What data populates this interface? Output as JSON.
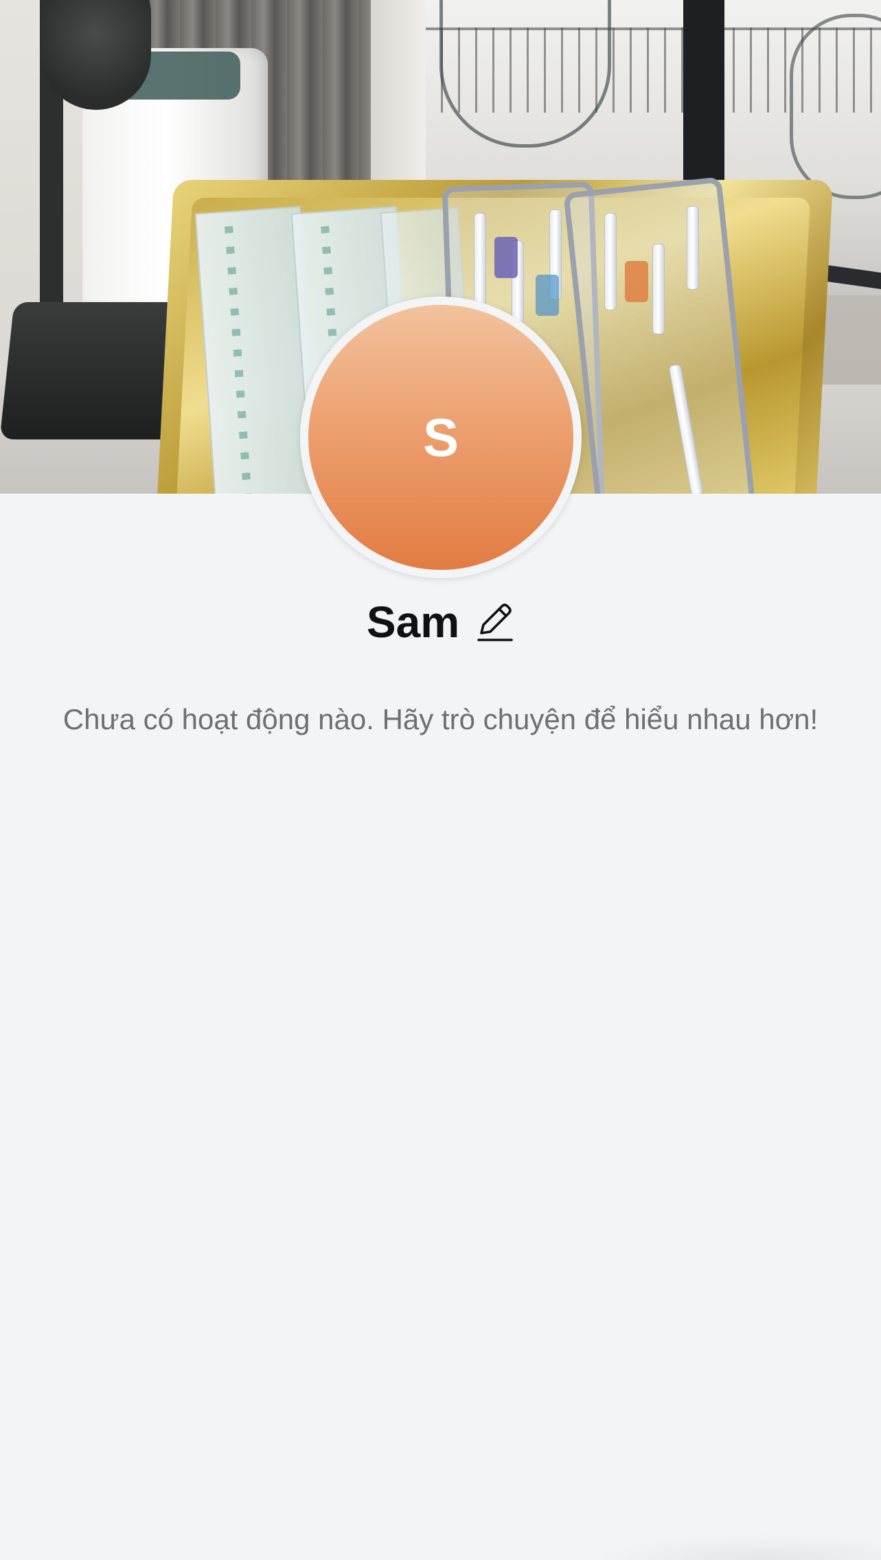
{
  "cover": {
    "alt_description": ""
  },
  "avatar": {
    "initial": "S",
    "colors": {
      "gradient_top": "#f2c29d",
      "gradient_bottom": "#e27c43"
    }
  },
  "profile": {
    "name": "Sam",
    "edit_icon": "pencil-icon"
  },
  "empty_state": {
    "message": "Chưa có hoạt động nào. Hãy trò chuyện để hiểu nhau hơn!"
  },
  "colors": {
    "page_background": "#f3f4f6",
    "name_text": "#111111",
    "muted_text": "#6e6e73"
  }
}
